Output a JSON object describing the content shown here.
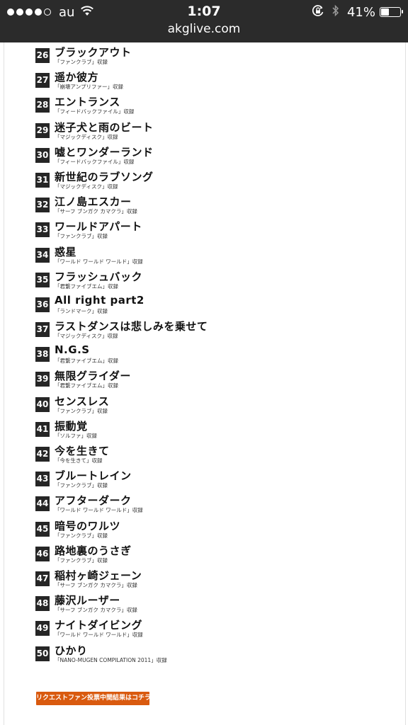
{
  "status_bar": {
    "carrier": "au",
    "signal_dots_filled": 4,
    "signal_dots_total": 5,
    "time": "1:07",
    "battery_percent_label": "41%",
    "battery_level": 0.41,
    "icons": [
      "wifi-icon",
      "rotation-lock-icon",
      "bluetooth-icon",
      "battery-icon"
    ]
  },
  "browser": {
    "url": "akglive.com"
  },
  "songs": [
    {
      "num": "26",
      "title": "ブラックアウト",
      "album": "「ファンクラブ」収録"
    },
    {
      "num": "27",
      "title": "遥か彼方",
      "album": "「崩壊アンプリファー」収録"
    },
    {
      "num": "28",
      "title": "エントランス",
      "album": "「フィードバックファイル」収録"
    },
    {
      "num": "29",
      "title": "迷子犬と雨のビート",
      "album": "「マジックディスク」収録"
    },
    {
      "num": "30",
      "title": "嘘とワンダーランド",
      "album": "「フィードバックファイル」収録"
    },
    {
      "num": "31",
      "title": "新世紀のラブソング",
      "album": "「マジックディスク」収録"
    },
    {
      "num": "32",
      "title": "江ノ島エスカー",
      "album": "「サーフ ブンガク カマクラ」収録"
    },
    {
      "num": "33",
      "title": "ワールドアパート",
      "album": "「ファンクラブ」収録"
    },
    {
      "num": "34",
      "title": "惑星",
      "album": "「ワールド ワールド ワールド」収録"
    },
    {
      "num": "35",
      "title": "フラッシュバック",
      "album": "「君繋ファイブエム」収録"
    },
    {
      "num": "36",
      "title": "All right part2",
      "album": "「ランドマーク」収録"
    },
    {
      "num": "37",
      "title": "ラストダンスは悲しみを乗せて",
      "album": "「マジックディスク」収録"
    },
    {
      "num": "38",
      "title": "N.G.S",
      "album": "「君繋ファイブエム」収録"
    },
    {
      "num": "39",
      "title": "無限グライダー",
      "album": "「君繋ファイブエム」収録"
    },
    {
      "num": "40",
      "title": "センスレス",
      "album": "「ファンクラブ」収録"
    },
    {
      "num": "41",
      "title": "振動覚",
      "album": "「ソルファ」収録"
    },
    {
      "num": "42",
      "title": "今を生きて",
      "album": "「今を生きて」収録"
    },
    {
      "num": "43",
      "title": "ブルートレイン",
      "album": "「ファンクラブ」収録"
    },
    {
      "num": "44",
      "title": "アフターダーク",
      "album": "「ワールド ワールド ワールド」収録"
    },
    {
      "num": "45",
      "title": "暗号のワルツ",
      "album": "「ファンクラブ」収録"
    },
    {
      "num": "46",
      "title": "路地裏のうさぎ",
      "album": "「ファンクラブ」収録"
    },
    {
      "num": "47",
      "title": "稲村ヶ崎ジェーン",
      "album": "「サーフ ブンガク カマクラ」収録"
    },
    {
      "num": "48",
      "title": "藤沢ルーザー",
      "album": "「サーフ ブンガク カマクラ」収録"
    },
    {
      "num": "49",
      "title": "ナイトダイビング",
      "album": "「ワールド ワールド ワールド」収録"
    },
    {
      "num": "50",
      "title": "ひかり",
      "album": "「NANO-MUGEN COMPILATION 2011」収録"
    }
  ],
  "request_button": {
    "label": "リクエストファン投票中間結果はコチラ",
    "color": "#d95a0f"
  }
}
